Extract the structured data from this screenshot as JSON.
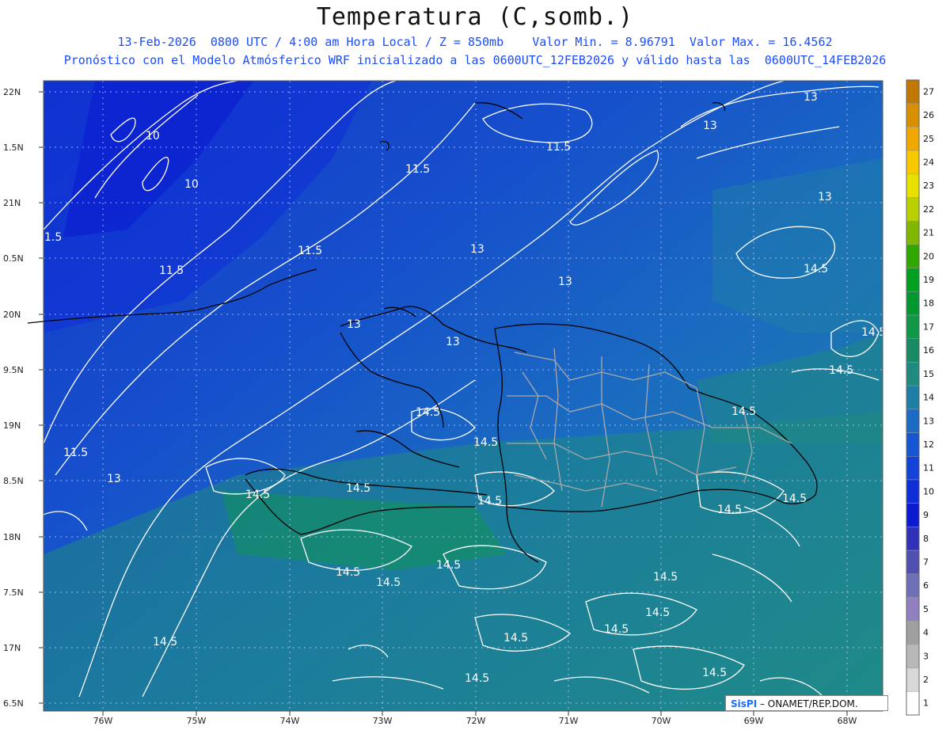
{
  "header": {
    "title": "Temperatura (C,somb.)",
    "line1": "13-Feb-2026  0800 UTC / 4:00 am Hora Local / Z = 850mb    Valor Min. = 8.96791  Valor Max. = 16.4562",
    "line2": "Pronóstico con el Modelo Atmósferico WRF inicializado a las 0600UTC_12FEB2026 y válido hasta las  0600UTC_14FEB2026"
  },
  "axes": {
    "lon_labels": [
      "76W",
      "75W",
      "74W",
      "73W",
      "72W",
      "71W",
      "70W",
      "69W",
      "68W"
    ],
    "lat_labels": [
      "22N",
      "1.5N",
      "21N",
      "0.5N",
      "20N",
      "9.5N",
      "19N",
      "8.5N",
      "18N",
      "7.5N",
      "17N",
      "6.5N"
    ]
  },
  "colorbar": {
    "levels": [
      "27",
      "26",
      "25",
      "24",
      "23",
      "22",
      "21",
      "20",
      "19",
      "18",
      "17",
      "16",
      "15",
      "14",
      "13",
      "12",
      "11",
      "10",
      "9",
      "8",
      "7",
      "6",
      "5",
      "4",
      "3",
      "2",
      "1"
    ],
    "colors": [
      "#c07800",
      "#d89000",
      "#f0a800",
      "#f8c800",
      "#e8e000",
      "#b8d000",
      "#80b800",
      "#30a800",
      "#00a020",
      "#00982f",
      "#109848",
      "#1a8a64",
      "#1f8a80",
      "#1f7ea6",
      "#1b6bc4",
      "#1756d2",
      "#1342d8",
      "#0f2ed8",
      "#0a1ad0",
      "#3030b8",
      "#5050b0",
      "#7070b8",
      "#9080c0",
      "#a0a0a0",
      "#b8b8b8",
      "#d8d8d8",
      "#ffffff"
    ]
  },
  "contour_labels": [
    "10",
    "10",
    "11.5",
    "11.5",
    "11.5",
    "13",
    "13",
    "13",
    "13",
    "13",
    "13",
    "13",
    "14.5",
    "14.5",
    "14.5",
    "14.5",
    "14.5",
    "14.5",
    "14.5",
    "14.5",
    "14.5",
    "14.5",
    "14.5",
    "14.5",
    "14.5",
    "14.5",
    "14.5",
    "14.5",
    "1.5",
    "11.5",
    "11.5",
    "14.5",
    "14.5",
    "14.5",
    "14.5",
    "14.5"
  ],
  "credit": {
    "brand": "SisPI",
    "text": " – ONAMET/REP.DOM."
  }
}
